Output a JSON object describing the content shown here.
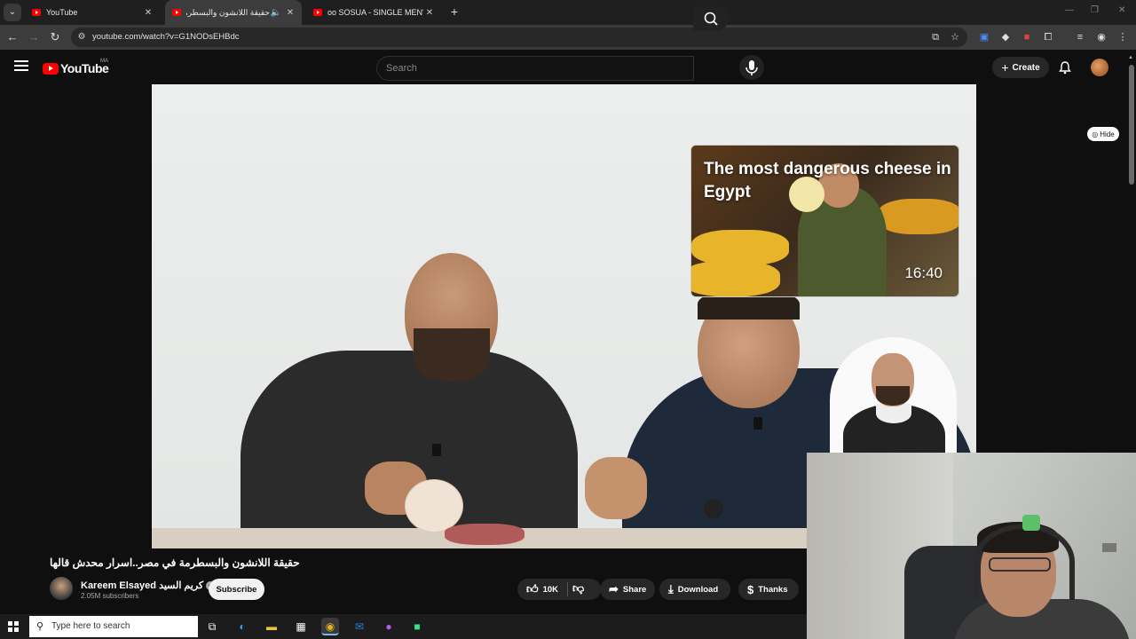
{
  "browser": {
    "tabs": [
      {
        "title": "YouTube",
        "active": false
      },
      {
        "title": "حقيقة اللانشون والبسطرمة",
        "active": true
      },
      {
        "title": "oo SOSUA - SINGLE MEN'S PAR",
        "active": false
      }
    ],
    "url": "youtube.com/watch?v=G1NODsEHBdc",
    "new_tab": "+",
    "window_controls": {
      "minimize": "—",
      "restore": "❐",
      "close": "✕"
    }
  },
  "youtube": {
    "logo_text": "YouTube",
    "country_code": "MA",
    "search_placeholder": "Search",
    "create_label": "Create"
  },
  "video": {
    "endcard_title": "The most dangerous cheese in Egypt",
    "endcard_duration": "16:40",
    "hide_label": "Hide"
  },
  "info": {
    "title": "حقيقة اللانشون والبسطرمة في مصر..اسرار محدش قالها",
    "channel_name": "Kareem Elsayed كريم السيد",
    "subscribers": "2.05M subscribers",
    "subscribe_label": "Subscribe",
    "likes": "10K",
    "share_label": "Share",
    "download_label": "Download",
    "thanks_label": "Thanks"
  },
  "taskbar": {
    "search_placeholder": "Type here to search"
  },
  "colors": {
    "yt_red": "#ff0000",
    "page_bg": "#0f0f0f",
    "pill_bg": "#272727"
  }
}
